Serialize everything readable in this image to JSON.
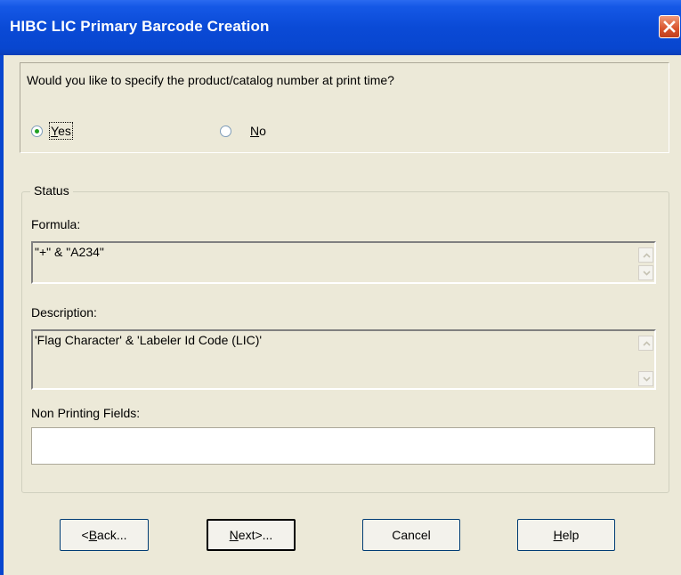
{
  "window": {
    "title": "HIBC LIC Primary Barcode Creation"
  },
  "question": {
    "text": "Would you like to specify the product/catalog number at print time?",
    "options": [
      {
        "label_underlined": "Y",
        "label_rest": "es",
        "checked": true
      },
      {
        "label_underlined": "N",
        "label_rest": "o",
        "checked": false
      }
    ]
  },
  "status": {
    "legend": "Status",
    "formula_label": "Formula:",
    "formula_value": "\"+\" & \"A234\"",
    "description_label": "Description:",
    "description_value": "'Flag Character'  &  'Labeler Id Code (LIC)'",
    "non_printing_label": "Non Printing Fields:",
    "non_printing_value": ""
  },
  "buttons": {
    "back": {
      "prefix": "<",
      "underlined": "B",
      "rest": "ack..."
    },
    "next": {
      "underlined": "N",
      "rest": "ext>..."
    },
    "cancel": {
      "label": "Cancel"
    },
    "help": {
      "underlined": "H",
      "rest": "elp"
    }
  },
  "colors": {
    "titlebar": "#0a4ad6",
    "dialog_bg": "#ece9d8",
    "close_button": "#d8532c"
  }
}
